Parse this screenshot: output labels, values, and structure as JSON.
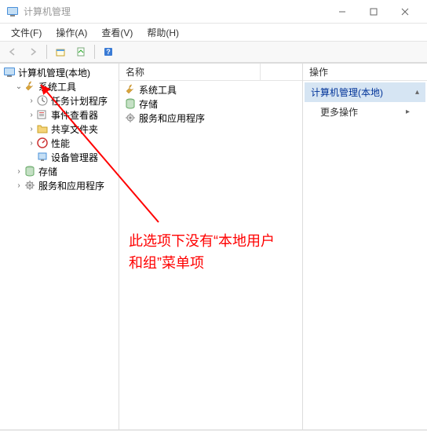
{
  "window": {
    "title": "计算机管理"
  },
  "menu": {
    "file": "文件(F)",
    "action": "操作(A)",
    "view": "查看(V)",
    "help": "帮助(H)"
  },
  "tree": {
    "root": "计算机管理(本地)",
    "system_tools": "系统工具",
    "task_scheduler": "任务计划程序",
    "event_viewer": "事件查看器",
    "shared_folders": "共享文件夹",
    "performance": "性能",
    "device_manager": "设备管理器",
    "storage": "存储",
    "services_apps": "服务和应用程序"
  },
  "list": {
    "header_name": "名称",
    "items": {
      "system_tools": "系统工具",
      "storage": "存储",
      "services_apps": "服务和应用程序"
    }
  },
  "actions": {
    "header": "操作",
    "root_item": "计算机管理(本地)",
    "more": "更多操作"
  },
  "annotation": {
    "text": "此选项下没有“本地用户和组”菜单项"
  },
  "icons": {
    "computer": "computer-mgmt-icon",
    "wrench": "wrench-icon",
    "clock": "clock-icon",
    "event": "event-icon",
    "folder": "folder-icon",
    "perf": "performance-icon",
    "device": "device-icon",
    "storage": "storage-icon",
    "gear": "gear-icon"
  },
  "colors": {
    "annotation": "#ff0000",
    "action_highlight": "#d6e5f3"
  }
}
